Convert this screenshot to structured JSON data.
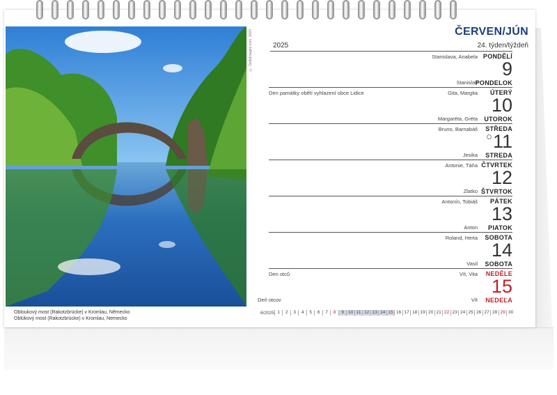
{
  "header": {
    "month": "ČERVEN/JÚN",
    "year": "2025",
    "week": "24. týden/týždeň"
  },
  "photo": {
    "credit": "© GettyImages.com, 2024",
    "caption_cz": "Obloukový most (Rakotzbrücke) v Kromlau, Německo",
    "caption_sk": "Oblúkový most (Rakotzbrücke) v Kromlau, Nemecko"
  },
  "days": [
    {
      "dn_cz": "PONDĚLÍ",
      "dn_sk": "PONDELOK",
      "num": "9",
      "names_top": "Stanislava, Anabela",
      "names_bot": "Stanislav",
      "event_top": "",
      "event_bot": "",
      "holiday": false
    },
    {
      "dn_cz": "ÚTERÝ",
      "dn_sk": "UTOROK",
      "num": "10",
      "names_top": "Gita, Margita",
      "names_bot": "Margaréta, Gréta",
      "event_top": "Den památky obětí vyhlazení obce Lidice",
      "event_bot": "",
      "holiday": false
    },
    {
      "dn_cz": "STŘEDA",
      "dn_sk": "STREDA",
      "num": "11",
      "names_top": "Bruno, Barnabáš",
      "names_bot": "Jesika",
      "event_top": "",
      "event_bot": "",
      "holiday": false
    },
    {
      "dn_cz": "ČTVRTEK",
      "dn_sk": "ŠTVRTOK",
      "num": "12",
      "names_top": "Antonie, Táňa",
      "names_bot": "Zlatko",
      "event_top": "",
      "event_bot": "",
      "holiday": false
    },
    {
      "dn_cz": "PÁTEK",
      "dn_sk": "PIATOK",
      "num": "13",
      "names_top": "Antonín, Tobiáš",
      "names_bot": "Anton",
      "event_top": "",
      "event_bot": "",
      "holiday": false
    },
    {
      "dn_cz": "SOBOTA",
      "dn_sk": "SOBOTA",
      "num": "14",
      "names_top": "Roland, Herta",
      "names_bot": "Vasil",
      "event_top": "",
      "event_bot": "",
      "holiday": false
    },
    {
      "dn_cz": "NEDĚLE",
      "dn_sk": "NEDEĽA",
      "num": "15",
      "names_top": "Vít, Vita",
      "names_bot": "Vít",
      "event_top": "Den otců",
      "event_bot": "Deň otcov",
      "holiday": true
    }
  ],
  "mini_month": {
    "label": "6/2025",
    "days": [
      "1",
      "2",
      "3",
      "4",
      "5",
      "6",
      "7",
      "8",
      "9",
      "10",
      "11",
      "12",
      "13",
      "14",
      "15",
      "16",
      "17",
      "18",
      "19",
      "20",
      "21",
      "22",
      "23",
      "24",
      "25",
      "26",
      "27",
      "28",
      "29",
      "30"
    ],
    "red_days": [
      "8",
      "15",
      "22",
      "29"
    ],
    "highlighted_days": [
      "9",
      "10",
      "11",
      "12",
      "13",
      "14",
      "15"
    ]
  },
  "colors": {
    "month": "#1d3f7a",
    "holiday": "#c0202a",
    "highlight": "#cfd8e6"
  }
}
